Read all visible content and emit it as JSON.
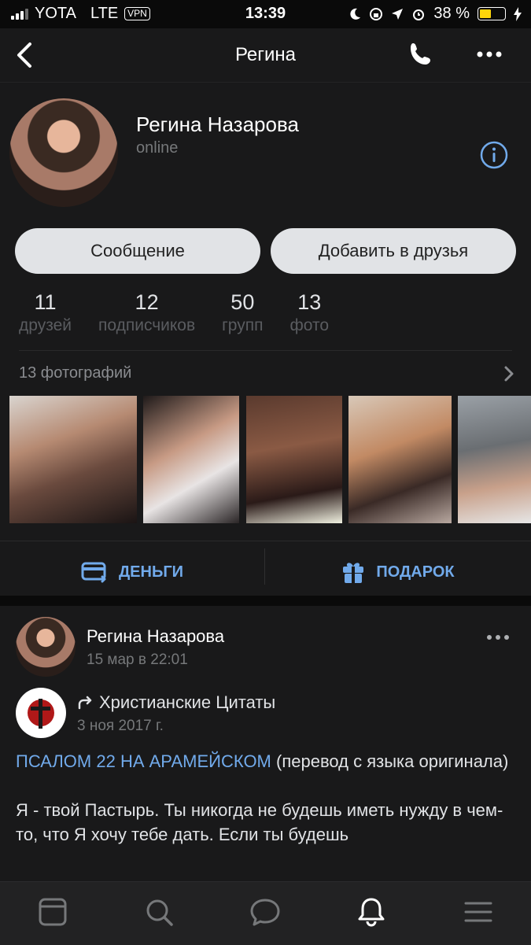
{
  "status_bar": {
    "carrier": "YOTA",
    "network": "LTE",
    "vpn": "VPN",
    "time": "13:39",
    "battery_percent": "38 %",
    "battery_level": 0.38,
    "battery_color": "#ffd60a"
  },
  "nav": {
    "title": "Регина",
    "icons": [
      "back-chevron-icon",
      "phone-icon",
      "more-icon"
    ]
  },
  "profile": {
    "name": "Регина Назарова",
    "status": "online",
    "message_button": "Сообщение",
    "add_friend_button": "Добавить в друзья",
    "stats": [
      {
        "value": "11",
        "label": "друзей"
      },
      {
        "value": "12",
        "label": "подписчиков"
      },
      {
        "value": "50",
        "label": "групп"
      },
      {
        "value": "13",
        "label": "фото"
      }
    ],
    "photos_header": "13 фотографий",
    "photos_count_visible": 5,
    "actions": [
      {
        "label": "ДЕНЬГИ",
        "icon": "money-card-icon"
      },
      {
        "label": "ПОДАРОК",
        "icon": "gift-icon"
      }
    ]
  },
  "post": {
    "author": "Регина Назарова",
    "date": "15 мар в 22:01",
    "repost_source": "Христианские Цитаты",
    "repost_date": "3 ноя 2017 г.",
    "text_link": "ПСАЛОМ 22 НА АРАМЕЙСКОМ",
    "text_after_link": " (перевод с языка оригинала)",
    "paragraph": "Я - твой Пастырь. Ты никогда не будешь иметь нужду в чем-то, что Я хочу тебе дать. Если ты будешь"
  },
  "colors": {
    "accent": "#71aaeb",
    "background": "#0a0a0a",
    "card": "#19191a"
  },
  "tabbar": {
    "icons": [
      "news-icon",
      "search-icon",
      "messages-icon",
      "notifications-icon",
      "menu-icon"
    ]
  }
}
